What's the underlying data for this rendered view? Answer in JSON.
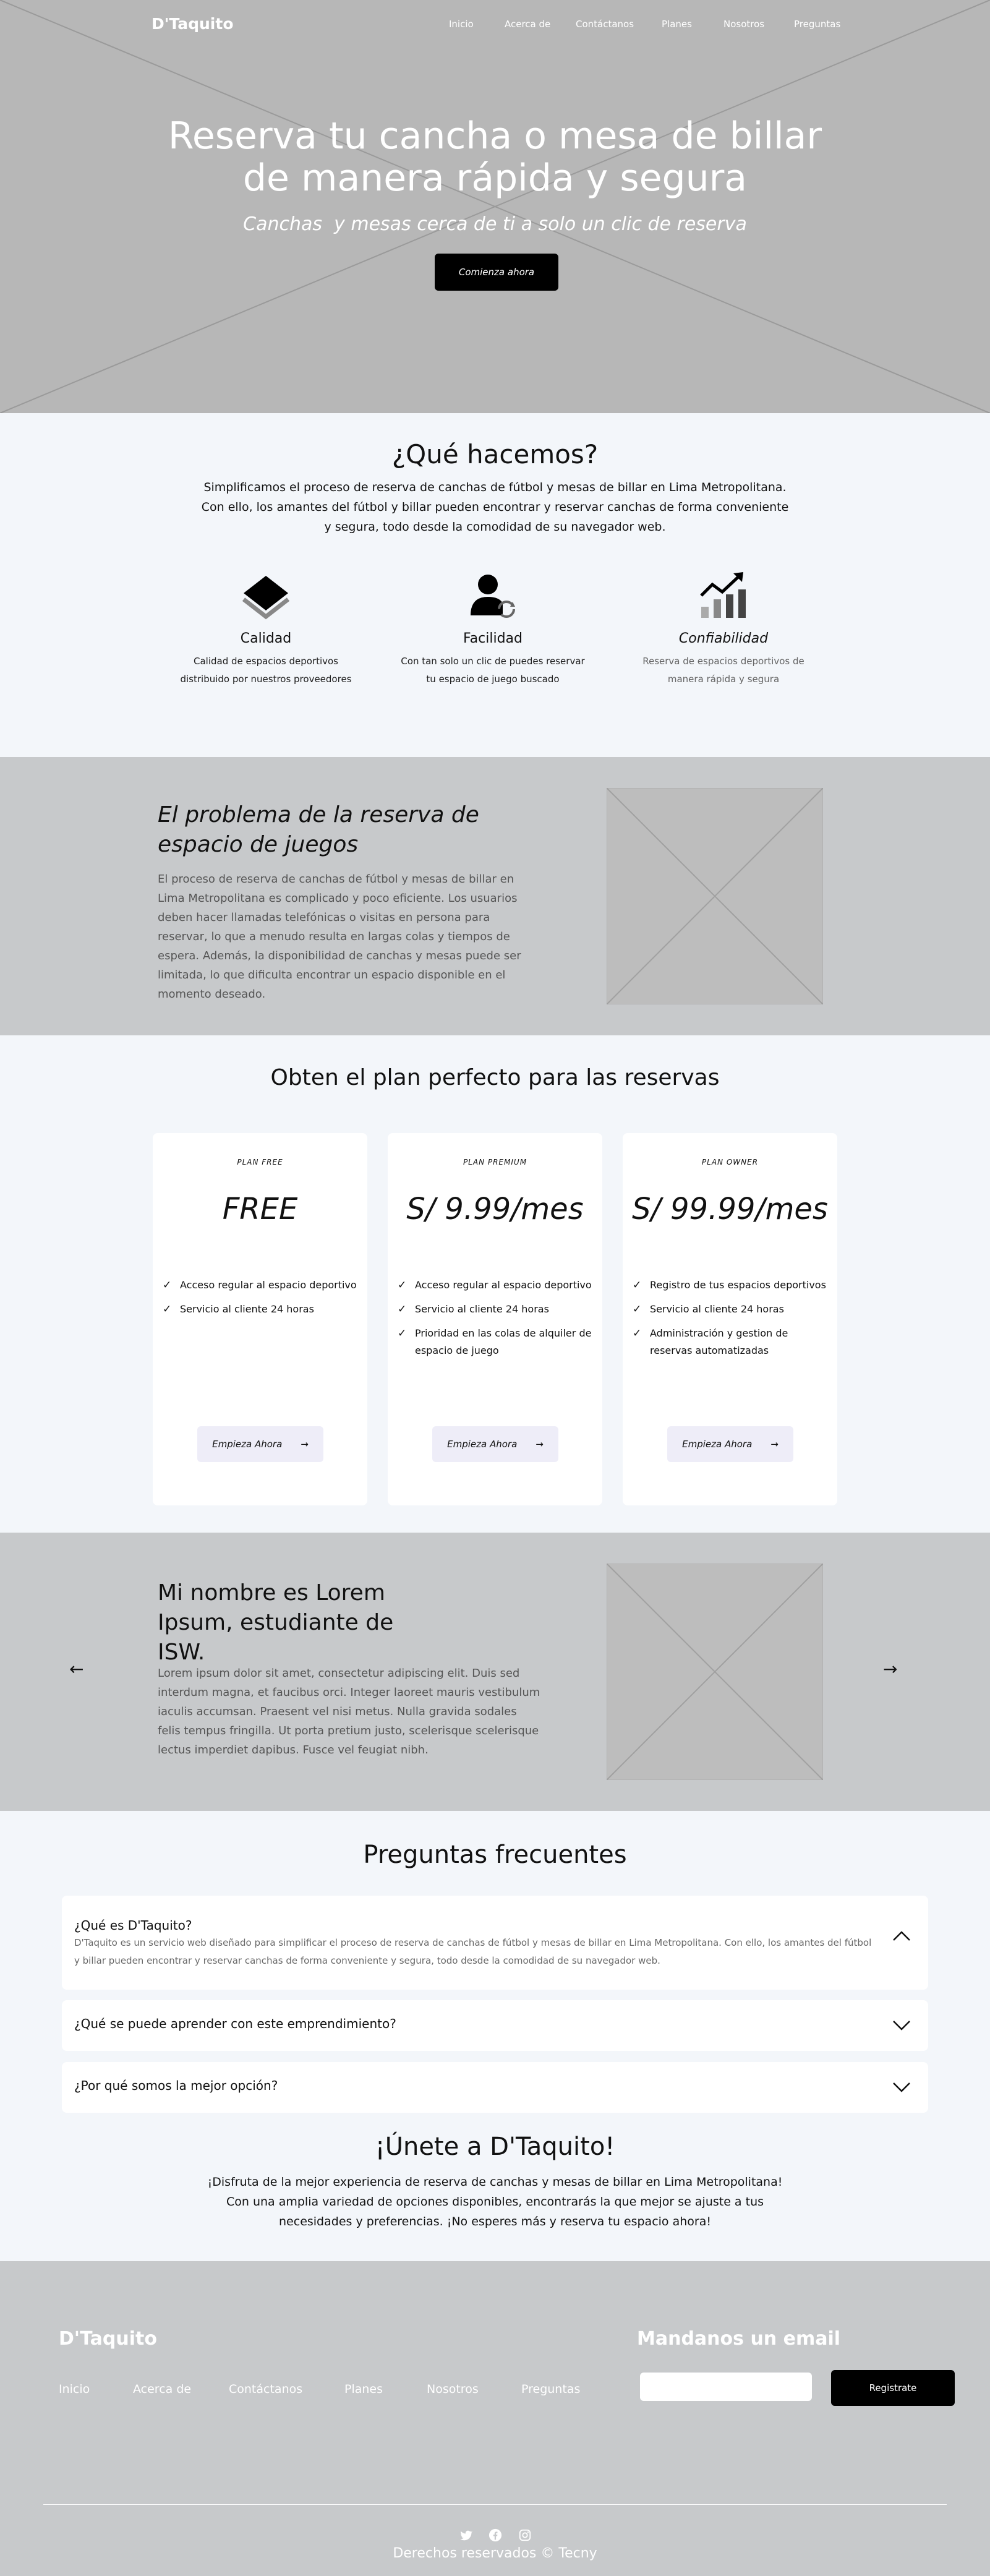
{
  "nav": {
    "brand": "D'Taquito",
    "links": [
      "Inicio",
      "Acerca de",
      "Contáctanos",
      "Planes",
      "Nosotros",
      "Preguntas"
    ]
  },
  "hero": {
    "title_line1": "Reserva tu cancha o mesa de billar",
    "title_line2": "de manera rápida y segura",
    "subtitle": "Canchas  y mesas cerca de ti a solo un clic de reserva",
    "cta": "Comienza ahora"
  },
  "what": {
    "title": "¿Qué hacemos?",
    "intro": "Simplificamos el proceso de reserva de canchas de fútbol y mesas de billar en Lima Metropolitana. Con ello, los amantes del fútbol y billar pueden encontrar y reservar canchas de forma conveniente y segura, todo desde la comodidad de su navegador web.",
    "features": [
      {
        "icon": "layers-icon",
        "title": "Calidad",
        "text": "Calidad de espacios deportivos distribuido por nuestros proveedores"
      },
      {
        "icon": "user-sync-icon",
        "title": "Facilidad",
        "text": "Con tan solo un clic de puedes reservar tu espacio de juego buscado"
      },
      {
        "icon": "chart-up-icon",
        "title": "Confiabilidad",
        "text": "Reserva de espacios deportivos de manera rápida y segura"
      }
    ]
  },
  "problem": {
    "title": "El problema de la reserva de espacio de juegos",
    "text": "El proceso de reserva de canchas de fútbol y mesas de billar en Lima Metropolitana es complicado y poco eficiente. Los usuarios deben hacer llamadas telefónicas o visitas en persona para reservar, lo que a menudo resulta en largas colas y tiempos de espera. Además, la disponibilidad de canchas y mesas puede ser limitada, lo que dificulta encontrar un espacio disponible en el momento deseado."
  },
  "plans": {
    "title": "Obten el plan perfecto para las reservas",
    "cards": [
      {
        "tag": "PLAN FREE",
        "price": "FREE",
        "features": [
          "Acceso regular al espacio deportivo",
          "Servicio al cliente 24 horas"
        ],
        "cta": "Empieza Ahora"
      },
      {
        "tag": "PLAN PREMIUM",
        "price": "S/ 9.99/mes",
        "features": [
          "Acceso regular al espacio deportivo",
          "Servicio al cliente 24 horas",
          "Prioridad en las colas de alquiler de espacio de juego"
        ],
        "cta": "Empieza Ahora"
      },
      {
        "tag": "PLAN OWNER",
        "price": "S/ 99.99/mes",
        "features": [
          "Registro de tus espacios deportivos",
          "Servicio al cliente 24 horas",
          "Administración y gestion de reservas automatizadas"
        ],
        "cta": "Empieza Ahora"
      }
    ]
  },
  "testimonial": {
    "title": "Mi nombre es Lorem Ipsum, estudiante de ISW.",
    "text": "Lorem ipsum dolor sit amet, consectetur adipiscing elit. Duis sed interdum magna, et faucibus orci. Integer laoreet mauris vestibulum iaculis accumsan. Praesent vel nisi metus. Nulla gravida sodales felis tempus fringilla. Ut porta pretium justo, scelerisque scelerisque lectus imperdiet dapibus. Fusce vel feugiat nibh."
  },
  "faq": {
    "title": "Preguntas frecuentes",
    "items": [
      {
        "q": "¿Qué es D'Taquito?",
        "a": "D'Taquito es un servicio web diseñado para simplificar el proceso de reserva de canchas de fútbol y mesas de billar en Lima Metropolitana. Con ello, los amantes del fútbol y billar pueden encontrar y reservar canchas de forma conveniente y segura, todo desde la comodidad de su navegador web."
      },
      {
        "q": "¿Qué se puede aprender con este emprendimiento?",
        "a": ""
      },
      {
        "q": "¿Por qué somos la mejor opción?",
        "a": ""
      }
    ]
  },
  "join": {
    "title": "¡Únete a D'Taquito!",
    "text": "¡Disfruta de la mejor experiencia de reserva de canchas y mesas de billar en Lima Metropolitana! Con una amplia variedad de opciones disponibles, encontrarás la que mejor se ajuste a tus necesidades y preferencias. ¡No esperes más y reserva tu espacio ahora!"
  },
  "footer": {
    "brand": "D'Taquito",
    "links": [
      "Inicio",
      "Acerca de",
      "Contáctanos",
      "Planes",
      "Nosotros",
      "Preguntas"
    ],
    "mail_title": "Mandanos un email",
    "email_placeholder": "",
    "subscribe": "Registrate",
    "social": [
      "twitter-icon",
      "facebook-icon",
      "instagram-icon"
    ],
    "copyright": "Derechos reservados © Tecny"
  },
  "colors": {
    "hero_bg": "#b7b7b7",
    "section_gray": "#c7c9cb",
    "light_bg": "#f3f6fa",
    "button_dark": "#000000",
    "plan_button": "#eeedf8"
  }
}
